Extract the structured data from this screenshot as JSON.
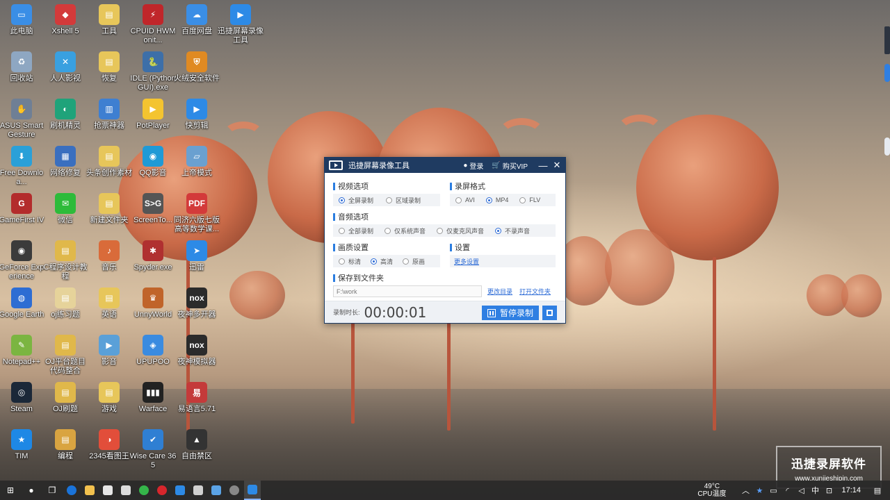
{
  "desktop": {
    "icons": [
      {
        "label": "此电脑",
        "color": "#3a8ee6",
        "glyph": "▭"
      },
      {
        "label": "回收站",
        "color": "#8ea7c2",
        "glyph": "♻"
      },
      {
        "label": "ASUS Smart Gesture",
        "color": "#6f7f95",
        "glyph": "✋"
      },
      {
        "label": "Free Downloa...",
        "color": "#2aa0d8",
        "glyph": "⬇"
      },
      {
        "label": "GameFirst IV",
        "color": "#b32c2c",
        "glyph": "G"
      },
      {
        "label": "GeForce Experience",
        "color": "#3b3b3b",
        "glyph": "◉"
      },
      {
        "label": "Google Earth",
        "color": "#2d6dd3",
        "glyph": "◍"
      },
      {
        "label": "Notepad++",
        "color": "#7bb541",
        "glyph": "✎"
      },
      {
        "label": "Steam",
        "color": "#1b2838",
        "glyph": "◎"
      },
      {
        "label": "TIM",
        "color": "#1e88e5",
        "glyph": "★"
      },
      {
        "label": "Xshell 5",
        "color": "#d33a3a",
        "glyph": "◆"
      },
      {
        "label": "人人影视",
        "color": "#39a0e0",
        "glyph": "✕"
      },
      {
        "label": "刷机精灵",
        "color": "#1fa37a",
        "glyph": "◐"
      },
      {
        "label": "网络修复",
        "color": "#3a6fbf",
        "glyph": "▦"
      },
      {
        "label": "微信",
        "color": "#2dbb3a",
        "glyph": "✉"
      },
      {
        "label": "C程序设计教程",
        "color": "#e0b84a",
        "glyph": "▤"
      },
      {
        "label": "oj练习题",
        "color": "#e6d39a",
        "glyph": "▤"
      },
      {
        "label": "OJ平台题目代码整合",
        "color": "#e0b84a",
        "glyph": "▤"
      },
      {
        "label": "OJ刷题",
        "color": "#e0b84a",
        "glyph": "▤"
      },
      {
        "label": "编程",
        "color": "#d9a441",
        "glyph": "▤"
      },
      {
        "label": "工具",
        "color": "#e7c65a",
        "glyph": "▤"
      },
      {
        "label": "恢复",
        "color": "#e7c65a",
        "glyph": "▤"
      },
      {
        "label": "抢票神器",
        "color": "#3e7fd1",
        "glyph": "▥"
      },
      {
        "label": "头条创作素材",
        "color": "#e7c65a",
        "glyph": "▤"
      },
      {
        "label": "新建文件夹",
        "color": "#e7c65a",
        "glyph": "▤"
      },
      {
        "label": "音乐",
        "color": "#d96b3a",
        "glyph": "♪"
      },
      {
        "label": "英语",
        "color": "#e7c65a",
        "glyph": "▤"
      },
      {
        "label": "影音",
        "color": "#5aa0d8",
        "glyph": "▶"
      },
      {
        "label": "游戏",
        "color": "#e7c65a",
        "glyph": "▤"
      },
      {
        "label": "2345看图王",
        "color": "#e24e3a",
        "glyph": "◑"
      },
      {
        "label": "CPUID HWMonit...",
        "color": "#c0262a",
        "glyph": "⚡"
      },
      {
        "label": "IDLE (Python GUI).exe",
        "color": "#3d6fa8",
        "glyph": "🐍"
      },
      {
        "label": "PotPlayer",
        "color": "#f4c430",
        "glyph": "▶"
      },
      {
        "label": "QQ影音",
        "color": "#1f9ad6",
        "glyph": "◉"
      },
      {
        "label": "ScreenTo...",
        "color": "#555",
        "glyph": "S>G"
      },
      {
        "label": "Spyder.exe",
        "color": "#b03030",
        "glyph": "✱"
      },
      {
        "label": "UnnyWorld",
        "color": "#c0642a",
        "glyph": "♛"
      },
      {
        "label": "UPUPOO",
        "color": "#3a8be0",
        "glyph": "◈"
      },
      {
        "label": "Warface",
        "color": "#222",
        "glyph": "▮▮▮"
      },
      {
        "label": "Wise Care 365",
        "color": "#2f7fd3",
        "glyph": "✔"
      },
      {
        "label": "百度网盘",
        "color": "#3a8ee6",
        "glyph": "☁"
      },
      {
        "label": "火绒安全软件",
        "color": "#e08a22",
        "glyph": "⛨"
      },
      {
        "label": "快剪辑",
        "color": "#2d8ae6",
        "glyph": "▶"
      },
      {
        "label": "上帝模式",
        "color": "#6aa0d0",
        "glyph": "▱"
      },
      {
        "label": "同济六版七版高等数学课...",
        "color": "#d33a3a",
        "glyph": "PDF"
      },
      {
        "label": "迅雷",
        "color": "#2d8ae6",
        "glyph": "➤"
      },
      {
        "label": "夜神多开器",
        "color": "#2b2b2b",
        "glyph": "nox"
      },
      {
        "label": "夜神模拟器",
        "color": "#2b2b2b",
        "glyph": "nox"
      },
      {
        "label": "易语言5.71",
        "color": "#c43a3a",
        "glyph": "易"
      },
      {
        "label": "自由禁区",
        "color": "#333",
        "glyph": "▲"
      },
      {
        "label": "迅捷屏幕录像工具",
        "color": "#2d8ae6",
        "glyph": "▶"
      }
    ]
  },
  "app": {
    "title": "迅捷屏幕录像工具",
    "login": "登录",
    "vip": "购买VIP",
    "minimize": "—",
    "close": "✕",
    "video_section": "视频选项",
    "video_options": [
      {
        "label": "全屏录制",
        "checked": true
      },
      {
        "label": "区域录制",
        "checked": false
      }
    ],
    "format_section": "录屏格式",
    "format_options": [
      {
        "label": "AVI",
        "checked": false
      },
      {
        "label": "MP4",
        "checked": true
      },
      {
        "label": "FLV",
        "checked": false
      }
    ],
    "audio_section": "音频选项",
    "audio_options": [
      {
        "label": "全部录制",
        "checked": false
      },
      {
        "label": "仅系统声音",
        "checked": false
      },
      {
        "label": "仅麦克风声音",
        "checked": false
      },
      {
        "label": "不录声音",
        "checked": true
      }
    ],
    "quality_section": "画质设置",
    "quality_options": [
      {
        "label": "标清",
        "checked": false
      },
      {
        "label": "高清",
        "checked": true
      },
      {
        "label": "原画",
        "checked": false
      }
    ],
    "settings_section": "设置",
    "more_settings": "更多设置",
    "save_section": "保存到文件夹",
    "save_path": "F:\\work",
    "change_dir": "更改目录",
    "open_folder": "打开文件夹",
    "rec_duration_label": "录制时长:",
    "rec_time": "00:00:01",
    "pause_label": "暂停录制"
  },
  "watermark": {
    "line1": "迅捷录屏软件",
    "line2": "www.xunjieshipin.com"
  },
  "taskbar": {
    "temperature": "49°C",
    "temperature_label": "CPU温度",
    "ime": "中",
    "time": "17:14"
  }
}
